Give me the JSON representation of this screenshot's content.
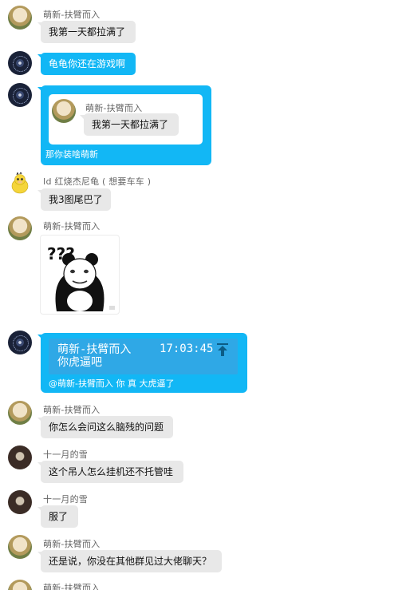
{
  "messages": {
    "m1": {
      "sender": "萌新-扶臂而入",
      "text": "我第一天都拉满了"
    },
    "m2": {
      "text": "龟龟你还在游戏啊"
    },
    "m3": {
      "quoted_sender": "萌新-扶臂而入",
      "quoted_text": "我第一天都拉满了",
      "reply": "那你装啥萌新"
    },
    "m4": {
      "sender": "Id 红烧杰尼龟 ( 想要车车 )",
      "text": "我3图尾巴了"
    },
    "m5": {
      "sender": "萌新-扶臂而入",
      "sticker_text": "???"
    },
    "m6": {
      "quoted_sender": "萌新-扶臂而入",
      "quoted_time": "17:03:45",
      "quoted_text": "你虎逼吧",
      "reply": "@萌新-扶臂而入 你 真 大虎逼了"
    },
    "m7": {
      "sender": "萌新-扶臂而入",
      "text": "你怎么会问这么脑残的问题"
    },
    "m8": {
      "sender": "十一月的雪",
      "text": "这个吊人怎么挂机还不托管哇"
    },
    "m9": {
      "sender": "十一月的雪",
      "text": "服了"
    },
    "m10": {
      "sender": "萌新-扶臂而入",
      "text": "还是说，你没在其他群见过大佬聊天？"
    },
    "m11": {
      "sender": "萌新-扶臂而入"
    }
  },
  "colors": {
    "bubble_gray": "#e8e8e8",
    "bubble_blue": "#12b7f5",
    "name_gray": "#666666"
  },
  "icons": {
    "jump": "arrow-up-to-bar-icon"
  }
}
